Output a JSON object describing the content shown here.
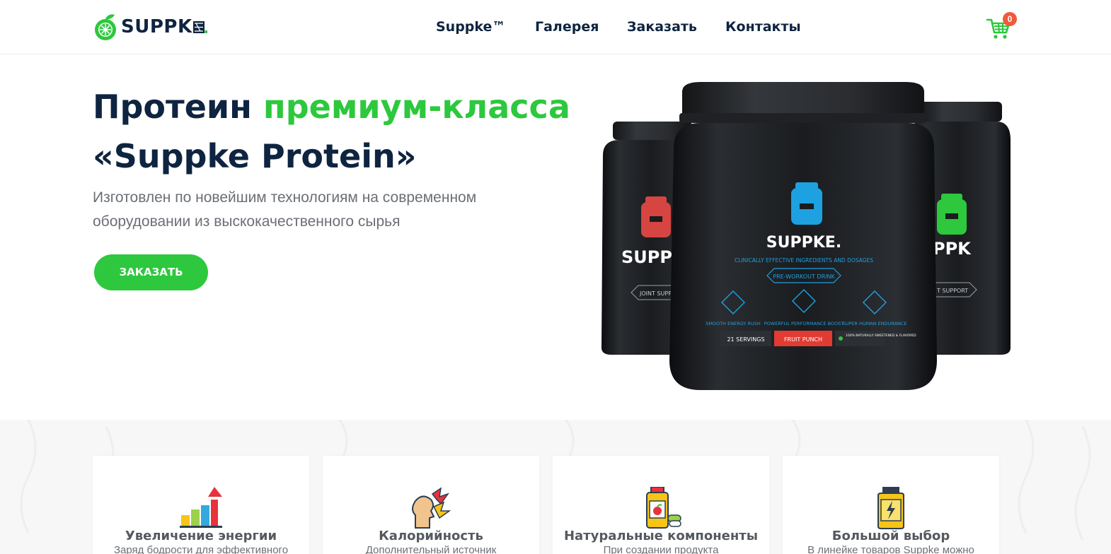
{
  "brand": {
    "name": "SUPPK",
    "tag": "E.",
    "accent_color": "#2dc83d",
    "dark_color": "#0e2440"
  },
  "nav": {
    "items": [
      {
        "label": "Suppke™"
      },
      {
        "label": "Галерея"
      },
      {
        "label": "Заказать"
      },
      {
        "label": "Контакты"
      }
    ]
  },
  "cart": {
    "icon": "shopping-cart-icon",
    "count": "0"
  },
  "hero": {
    "title_part1": "Протеин ",
    "title_accent": "премиум-класса",
    "title_part2": "«Suppke Protein»",
    "subtitle": "Изготовлен по новейшим технологиям на современном оборудовании из выскокачественного сырья",
    "cta_label": "ЗАКАЗАТЬ"
  },
  "product_image": {
    "center_jar": {
      "brand": "SUPPKE.",
      "tagline": "CLINICALLY EFFECTIVE INGREDIENTS AND DOSAGES",
      "product": "PRE-WORKOUT DRINK",
      "servings": "21 SERVINGS",
      "flavor": "FRUIT PUNCH",
      "badge": "100% NATURALLY SWEETENED & FLAVORED",
      "features": [
        "SMOOTH ENERGY RUSH",
        "POWERFUL PERFORMANCE BOOST",
        "SUPER HUMAN ENDURANCE"
      ]
    },
    "left_jar": {
      "brand": "SUPPK",
      "product": "JOINT SUPPORT"
    },
    "right_jar": {
      "brand": "PPK",
      "product": "T SUPPORT"
    }
  },
  "features": [
    {
      "icon": "energy-chart-icon",
      "title": "Увеличение энергии",
      "text": "Заряд бодрости для эффективного"
    },
    {
      "icon": "calories-icon",
      "title": "Калорийность",
      "text": "Дополнительный источник"
    },
    {
      "icon": "natural-supplement-icon",
      "title": "Натуральные компоненты",
      "text": "При создании продукта"
    },
    {
      "icon": "product-jar-icon",
      "title": "Большой выбор",
      "text": "В линейке товаров Suppke можно"
    }
  ]
}
